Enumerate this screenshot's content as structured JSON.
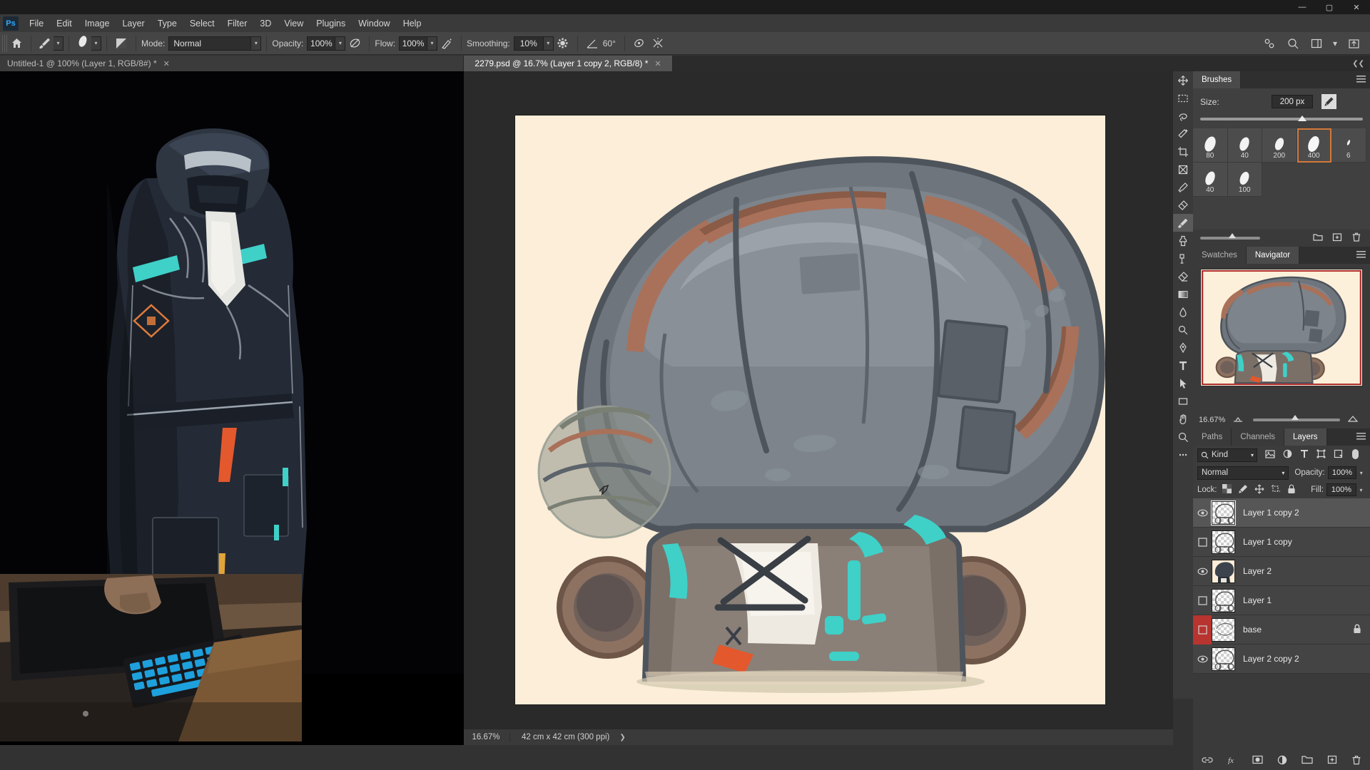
{
  "app": {
    "name": "Adobe Photoshop",
    "logo_text": "Ps",
    "window_controls": {
      "minimize": "—",
      "maximize": "▢",
      "close": "✕"
    }
  },
  "menubar": {
    "items": [
      "File",
      "Edit",
      "Image",
      "Layer",
      "Type",
      "Select",
      "Filter",
      "3D",
      "View",
      "Plugins",
      "Window",
      "Help"
    ]
  },
  "options_bar": {
    "mode_label": "Mode:",
    "mode_value": "Normal",
    "opacity_label": "Opacity:",
    "opacity_value": "100%",
    "flow_label": "Flow:",
    "flow_value": "100%",
    "smoothing_label": "Smoothing:",
    "smoothing_value": "10%",
    "angle_value": "60°",
    "brush_size_preview": "200"
  },
  "tabs": [
    {
      "label": "Untitled-1 @ 100% (Layer 1, RGB/8#) *",
      "active": false,
      "close": "✕"
    },
    {
      "label": "2279.psd @ 16.7% (Layer 1 copy 2, RGB/8) *",
      "active": true,
      "close": "✕"
    }
  ],
  "status_bar": {
    "zoom": "16.67%",
    "doc_dimensions": "42 cm x 42 cm (300 ppi)",
    "chevron": "❯"
  },
  "tools": [
    {
      "name": "move-tool",
      "icon": "move"
    },
    {
      "name": "marquee-tool",
      "icon": "marquee"
    },
    {
      "name": "lasso-tool",
      "icon": "lasso"
    },
    {
      "name": "quick-select-tool",
      "icon": "wand"
    },
    {
      "name": "crop-tool",
      "icon": "crop"
    },
    {
      "name": "frame-tool",
      "icon": "frame"
    },
    {
      "name": "eyedropper-tool",
      "icon": "eyedropper"
    },
    {
      "name": "healing-brush-tool",
      "icon": "healing"
    },
    {
      "name": "brush-tool",
      "icon": "brush",
      "active": true
    },
    {
      "name": "clone-stamp-tool",
      "icon": "stamp"
    },
    {
      "name": "history-brush-tool",
      "icon": "history"
    },
    {
      "name": "eraser-tool",
      "icon": "eraser"
    },
    {
      "name": "gradient-tool",
      "icon": "gradient"
    },
    {
      "name": "blur-tool",
      "icon": "blur"
    },
    {
      "name": "dodge-tool",
      "icon": "dodge"
    },
    {
      "name": "pen-tool",
      "icon": "pen"
    },
    {
      "name": "type-tool",
      "icon": "type"
    },
    {
      "name": "path-selection-tool",
      "icon": "path-arrow"
    },
    {
      "name": "rectangle-tool",
      "icon": "rectangle"
    },
    {
      "name": "hand-tool",
      "icon": "hand"
    },
    {
      "name": "zoom-tool",
      "icon": "magnifier"
    },
    {
      "name": "edit-toolbar-button",
      "icon": "ellipsis"
    }
  ],
  "brushes_panel": {
    "tab_label": "Brushes",
    "size_label": "Size:",
    "size_value": "200 px",
    "brushes": [
      {
        "label": "80",
        "tip": 22
      },
      {
        "label": "40",
        "tip": 19
      },
      {
        "label": "200",
        "tip": 17
      },
      {
        "label": "400",
        "tip": 23,
        "selected": true
      },
      {
        "label": "6",
        "tip": 5
      },
      {
        "label": "40",
        "tip": 19
      },
      {
        "label": "100",
        "tip": 18
      }
    ],
    "selection_color": "#d4783a"
  },
  "navigator_panel": {
    "tabs": [
      {
        "label": "Swatches",
        "active": false
      },
      {
        "label": "Navigator",
        "active": true
      }
    ],
    "zoom_value": "16.67%"
  },
  "layers_panel": {
    "tabs": [
      {
        "label": "Paths",
        "active": false
      },
      {
        "label": "Channels",
        "active": false
      },
      {
        "label": "Layers",
        "active": true
      }
    ],
    "filter_kind_label": "Kind",
    "blend_mode": "Normal",
    "opacity_label": "Opacity:",
    "opacity_value": "100%",
    "lock_label": "Lock:",
    "fill_label": "Fill:",
    "fill_value": "100%",
    "layers": [
      {
        "name": "Layer 1 copy 2",
        "visible": true,
        "selected": true,
        "thumb": "art",
        "locked": false,
        "marked": false
      },
      {
        "name": "Layer 1 copy",
        "visible": false,
        "selected": false,
        "thumb": "art",
        "locked": false,
        "marked": false
      },
      {
        "name": "Layer 2",
        "visible": true,
        "selected": false,
        "thumb": "helmet",
        "locked": false,
        "marked": false
      },
      {
        "name": "Layer 1",
        "visible": false,
        "selected": false,
        "thumb": "art",
        "locked": false,
        "marked": false
      },
      {
        "name": "base",
        "visible": false,
        "selected": false,
        "thumb": "empty",
        "locked": true,
        "marked": true
      },
      {
        "name": "Layer 2 copy 2",
        "visible": true,
        "selected": false,
        "thumb": "art",
        "locked": false,
        "marked": false
      }
    ]
  },
  "colors": {
    "canvas_background": "#fceed8",
    "app_chrome": "#3a3a3a",
    "panel_bg": "#404040",
    "accent_orange": "#d4783a",
    "accent_teal": "#3fd0c8",
    "marked_red": "#b8342f",
    "workspace_bg": "#2a2a2a",
    "helmet_gray": "#7b8289",
    "helmet_dark": "#4e545c",
    "strap_brown": "#a9715a"
  }
}
